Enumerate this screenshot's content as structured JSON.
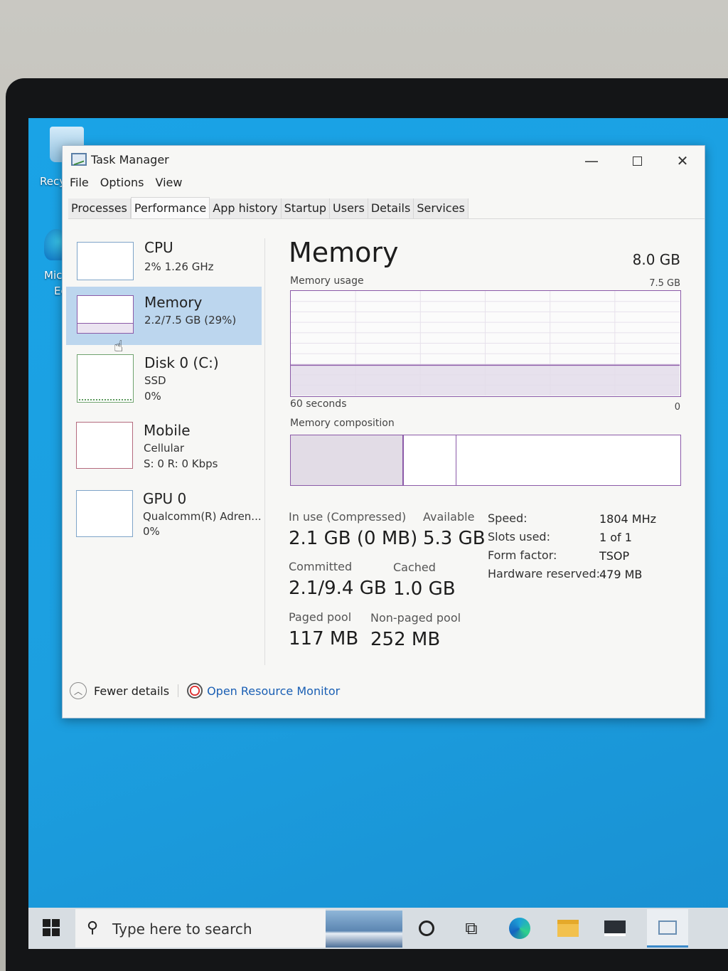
{
  "window": {
    "title": "Task Manager",
    "controls": {
      "minimize": "—",
      "close": "✕"
    }
  },
  "menu": [
    "File",
    "Options",
    "View"
  ],
  "tabs": [
    "Processes",
    "Performance",
    "App history",
    "Startup",
    "Users",
    "Details",
    "Services"
  ],
  "active_tab": "Performance",
  "resources": [
    {
      "name": "CPU",
      "lines": [
        "2%  1.26 GHz"
      ]
    },
    {
      "name": "Memory",
      "lines": [
        "2.2/7.5 GB (29%)"
      ],
      "selected": true
    },
    {
      "name": "Disk 0 (C:)",
      "lines": [
        "SSD",
        "0%"
      ]
    },
    {
      "name": "Mobile",
      "lines": [
        "Cellular",
        "S: 0 R: 0 Kbps"
      ]
    },
    {
      "name": "GPU 0",
      "lines": [
        "Qualcomm(R) Adren...",
        "0%"
      ]
    }
  ],
  "memory": {
    "title": "Memory",
    "total": "8.0 GB",
    "usage_label": "Memory usage",
    "usage_max": "7.5 GB",
    "time_label": "60 seconds",
    "zero_label": "0",
    "used_fraction": 0.29,
    "composition_label": "Memory composition",
    "composition": {
      "in_use_fraction": 0.29,
      "modified_fraction": 0.135
    },
    "stats": {
      "in_use": {
        "label": "In use (Compressed)",
        "value": "2.1 GB (0 MB)"
      },
      "available": {
        "label": "Available",
        "value": "5.3 GB"
      },
      "committed": {
        "label": "Committed",
        "value": "2.1/9.4 GB"
      },
      "cached": {
        "label": "Cached",
        "value": "1.0 GB"
      },
      "paged_pool": {
        "label": "Paged pool",
        "value": "117 MB"
      },
      "non_paged_pool": {
        "label": "Non-paged pool",
        "value": "252 MB"
      }
    },
    "details": [
      {
        "key": "Speed:",
        "value": "1804 MHz"
      },
      {
        "key": "Slots used:",
        "value": "1 of 1"
      },
      {
        "key": "Form factor:",
        "value": "TSOP"
      },
      {
        "key": "Hardware reserved:",
        "value": "479 MB"
      }
    ]
  },
  "footer": {
    "fewer_details": "Fewer details",
    "open_monitor": "Open Resource Monitor"
  },
  "taskbar": {
    "search_placeholder": "Type here to search"
  },
  "desktop": {
    "recycle_bin_label": "Recy",
    "edge_label_1": "Mic",
    "edge_label_2": "Ed"
  },
  "colors": {
    "memory_accent": "#8b5aa8",
    "selection": "#bcd6ee",
    "link": "#1a5fb4",
    "desktop": "#1c9fe0"
  }
}
